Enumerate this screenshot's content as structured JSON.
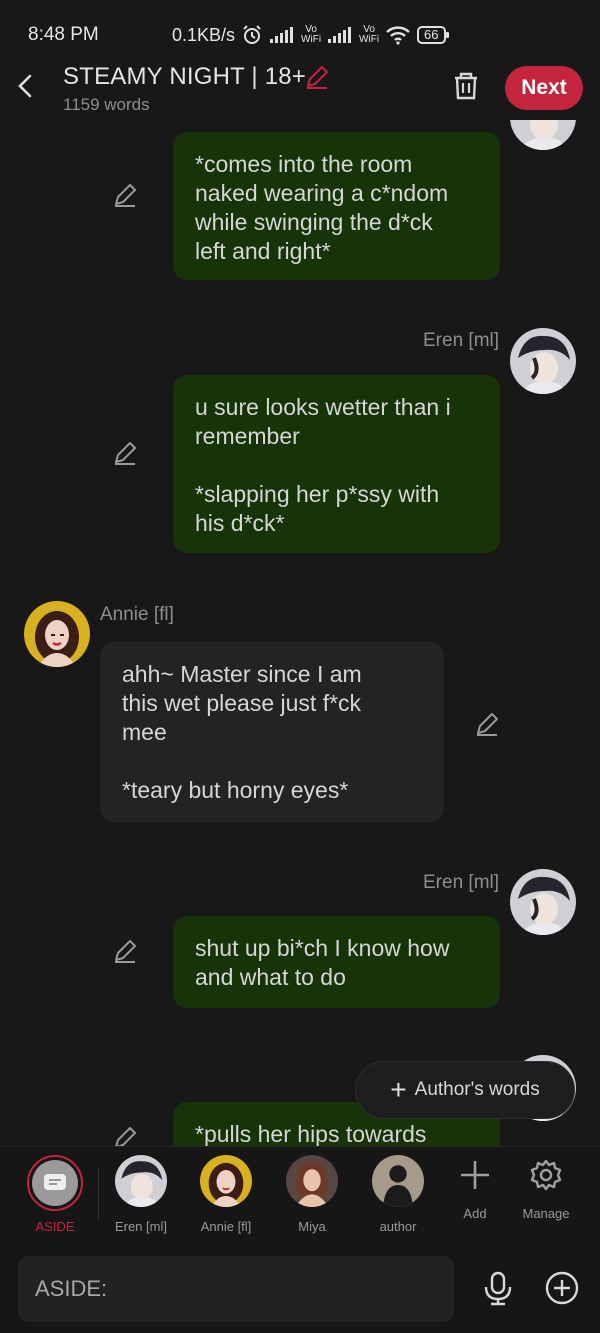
{
  "status_bar": {
    "time": "8:48 PM",
    "net_speed": "0.1KB/s",
    "vo1_top": "Vo",
    "vo1_bottom": "WiFi",
    "vo2_top": "Vo",
    "vo2_bottom": "WiFi",
    "battery": "66"
  },
  "header": {
    "title": "STEAMY NIGHT | 18+",
    "word_count": "1159 words",
    "next_label": "Next"
  },
  "messages": [
    {
      "sender": "",
      "text": "*comes into the room\nnaked wearing a c*ndom\nwhile swinging the d*ck\nleft and right*"
    },
    {
      "sender": "Eren [ml]",
      "text": "u sure looks wetter than i\nremember\n\n*slapping her p*ssy with\nhis d*ck*"
    },
    {
      "sender": "Annie [fl]",
      "text": "ahh~ Master since I am\nthis wet please just f*ck\nmee\n\n*teary but horny eyes*"
    },
    {
      "sender": "Eren [ml]",
      "text": "shut up bi*ch I know how\nand what to do"
    },
    {
      "sender": "",
      "text": "*pulls her hips towards"
    }
  ],
  "authors_words_label": "Author's words",
  "roster": {
    "aside": "ASIDE",
    "eren": "Eren [ml]",
    "annie": "Annie [fl]",
    "miya": "Miya",
    "author": "author",
    "add": "Add",
    "manage": "Manage"
  },
  "input": {
    "placeholder": "ASIDE:"
  },
  "colors": {
    "accent": "#c5243f",
    "bubble_user": "#173308",
    "bubble_char": "#232323",
    "background": "#181818"
  }
}
